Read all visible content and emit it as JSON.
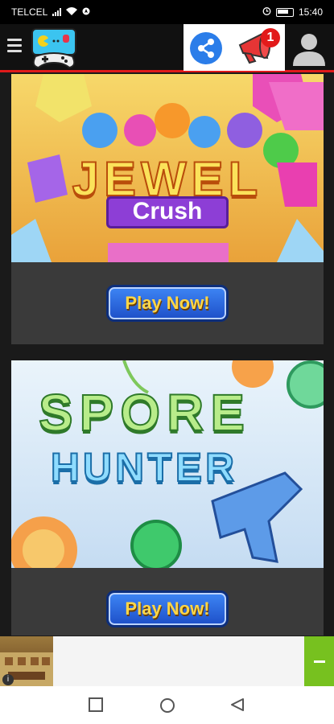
{
  "status_bar": {
    "carrier": "TELCEL",
    "time": "15:40"
  },
  "header": {
    "menu_icon": "hamburger-icon",
    "logo_icon": "gamepad-tv-logo",
    "share_icon": "share-icon",
    "notification_icon": "megaphone-icon",
    "notification_count": "1",
    "user_icon": "user-icon",
    "accent_color": "#e01a1a"
  },
  "games": [
    {
      "title_line1": "JEWEL",
      "title_line2": "Crush",
      "play_label": "Play Now!"
    },
    {
      "title_line1": "SPORE",
      "title_line2": "HUNTER",
      "play_label": "Play Now!"
    }
  ],
  "ad": {
    "info_label": "i"
  },
  "nav": {
    "icons": [
      "recent-apps-icon",
      "home-icon",
      "back-icon"
    ]
  }
}
